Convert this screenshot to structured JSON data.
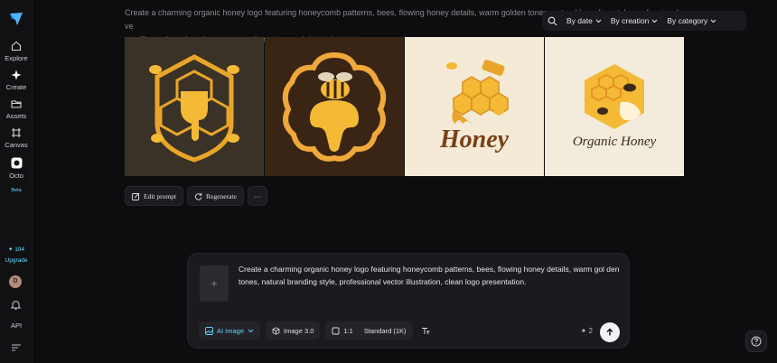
{
  "sidebar": {
    "items": [
      {
        "label": "Explore",
        "icon": "home-icon"
      },
      {
        "label": "Create",
        "icon": "sparkle-icon"
      },
      {
        "label": "Assets",
        "icon": "folder-icon"
      },
      {
        "label": "Canvas",
        "icon": "canvas-icon"
      },
      {
        "label": "Octo",
        "icon": "octo-icon",
        "badge": "Beta"
      }
    ],
    "credits": "✦ 104",
    "upgrade": "Upgrade",
    "avatar": "D",
    "api": "API"
  },
  "prompt_heading": {
    "line1": "Create a charming organic honey logo featuring honeycomb patterns, bees, flowing honey details, warm golden tones, natural branding style, professional ve",
    "line2": "ctor illustration, clean logo presentation.",
    "model": "Image 3.0",
    "ratio": "1:1",
    "quality": "1K"
  },
  "filters": {
    "date": "By date",
    "creation": "By creation",
    "category": "By category"
  },
  "images": [
    {
      "bg": "#3a3226",
      "text": ""
    },
    {
      "bg": "#3a2414",
      "text": ""
    },
    {
      "bg": "#f4ead6",
      "text": "Honey"
    },
    {
      "bg": "#f3ebdc",
      "text": "Organic Honey"
    }
  ],
  "actions": {
    "edit_prompt": "Edit prompt",
    "regenerate": "Regenerate",
    "more": "···"
  },
  "composer": {
    "text": "Create a charming organic honey logo featuring honeycomb patterns, bees, flowing honey details, warm gol den tones, natural branding style, professional vector illustration, clean logo presentation.",
    "upload_symbol": "+",
    "mode": "AI Image",
    "model": "Image 3.0",
    "ratio": "1:1",
    "quality": "Standard (1K)",
    "cost": "✦ 2"
  },
  "colors": {
    "accent": "#5fd4ff",
    "honey": "#e9a52a",
    "honey_dark": "#7a3f16"
  }
}
